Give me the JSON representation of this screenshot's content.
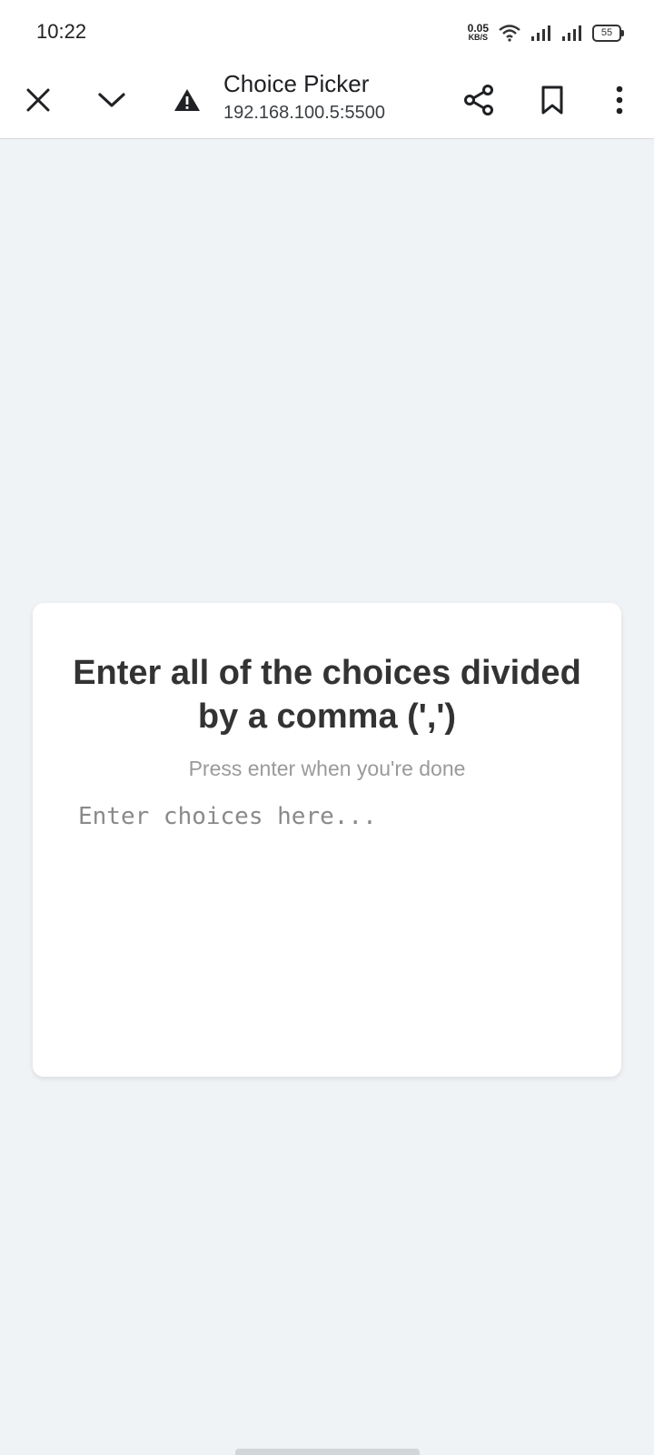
{
  "status_bar": {
    "time": "10:22",
    "net_speed_value": "0.05",
    "net_speed_unit": "KB/S",
    "battery": "55"
  },
  "toolbar": {
    "title": "Choice Picker",
    "url": "192.168.100.5:5500",
    "icons": [
      "close-icon",
      "chevron-down-icon",
      "warning-icon",
      "share-icon",
      "bookmark-icon",
      "more-vert-icon"
    ]
  },
  "card": {
    "heading": "Enter all of the choices divided by a comma (',')",
    "hint": "Press enter when you're done",
    "input_placeholder": "Enter choices here...",
    "input_value": ""
  },
  "colors": {
    "page_background": "#f0f3f6",
    "card_background": "#ffffff",
    "heading_text": "#333333",
    "hint_text": "#9a9a9a"
  }
}
